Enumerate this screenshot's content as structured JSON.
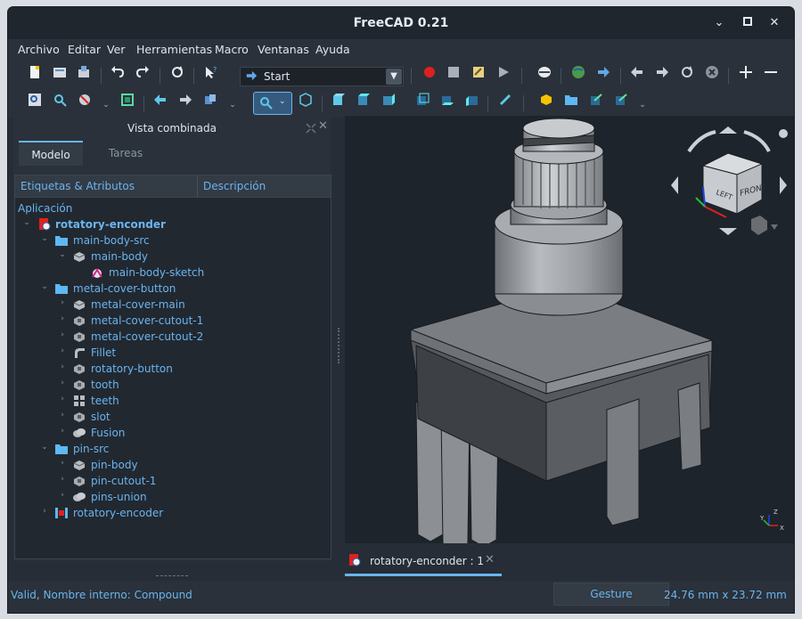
{
  "window": {
    "title": "FreeCAD 0.21"
  },
  "menu": [
    "Archivo",
    "Editar",
    "Ver",
    "Herramientas",
    "Macro",
    "Ventanas",
    "Ayuda"
  ],
  "toolbar": {
    "workbench": "Start"
  },
  "combo_view": {
    "title": "Vista combinada",
    "tabs": [
      "Modelo",
      "Tareas"
    ],
    "columns": [
      "Etiquetas & Atributos",
      "Descripción"
    ],
    "section": "Aplicación",
    "items": [
      {
        "label": "rotatory-enconder",
        "icon": "document-icon"
      },
      {
        "label": "main-body-src",
        "icon": "folder-icon"
      },
      {
        "label": "main-body",
        "icon": "extrude-icon"
      },
      {
        "label": "main-body-sketch",
        "icon": "sketch-icon"
      },
      {
        "label": "metal-cover-button",
        "icon": "folder-icon"
      },
      {
        "label": "metal-cover-main",
        "icon": "extrude-icon"
      },
      {
        "label": "metal-cover-cutout-1",
        "icon": "cut-icon"
      },
      {
        "label": "metal-cover-cutout-2",
        "icon": "cut-icon"
      },
      {
        "label": "Fillet",
        "icon": "fillet-icon"
      },
      {
        "label": "rotatory-button",
        "icon": "cut-icon"
      },
      {
        "label": "tooth",
        "icon": "cut-icon"
      },
      {
        "label": "teeth",
        "icon": "array-icon"
      },
      {
        "label": "slot",
        "icon": "cut-icon"
      },
      {
        "label": "Fusion",
        "icon": "fusion-icon"
      },
      {
        "label": "pin-src",
        "icon": "folder-icon"
      },
      {
        "label": "pin-body",
        "icon": "extrude-icon"
      },
      {
        "label": "pin-cutout-1",
        "icon": "cut-icon"
      },
      {
        "label": "pins-union",
        "icon": "fusion-icon"
      },
      {
        "label": "rotatory-encoder",
        "icon": "compound-icon"
      }
    ]
  },
  "navcube": {
    "front": "FRONT",
    "left": "LEFT",
    "axis_z": "Z",
    "axis_y": "Y",
    "axis_x": "X"
  },
  "document_tab": {
    "label": "rotatory-enconder : 1"
  },
  "statusbar": {
    "message": "Valid, Nombre interno: Compound",
    "navigation": "Gesture",
    "dimensions": "24.76 mm x 23.72 mm"
  },
  "colors": {
    "accent": "#6ab4ef",
    "background": "#262d36",
    "viewport": "#1e242b",
    "record": "#e02020"
  }
}
